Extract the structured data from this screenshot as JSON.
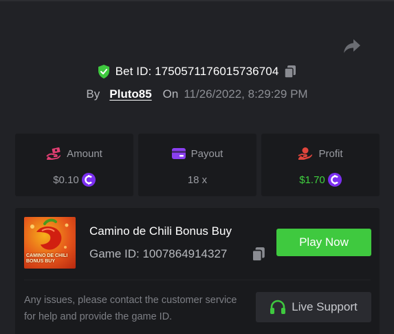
{
  "bet": {
    "id_text": "Bet ID: 1750571176015736704",
    "by_label": "By",
    "username": "Pluto85",
    "on_label": "On",
    "datetime": "11/26/2022, 8:29:29 PM"
  },
  "stats": [
    {
      "label": "Amount",
      "value": "$0.10",
      "icon": "hand-money-icon",
      "coin": true
    },
    {
      "label": "Payout",
      "value": "18 x",
      "icon": "wallet-card-icon",
      "coin": false
    },
    {
      "label": "Profit",
      "value": "$1.70",
      "icon": "profit-hand-icon",
      "coin": true
    }
  ],
  "game": {
    "title": "Camino de Chili Bonus Buy",
    "id_text": "Game ID: 1007864914327",
    "thumbnail_text": "CAMINO DE CHILI BONUS BUY",
    "play_label": "Play Now"
  },
  "support": {
    "notice": "Any issues, please contact the customer service for help and provide the game ID.",
    "button_label": "Live Support"
  },
  "colors": {
    "background": "#212226",
    "card": "#191a1d",
    "accent_green": "#3fc93f",
    "profit_green": "#3fcf3f",
    "coin_purple": "#7b2ff0",
    "amount_icon_pink": "#e03e72",
    "payout_icon_purple": "#8a3ff0",
    "profit_icon_red": "#e0453c",
    "verified_green": "#3fc93f"
  }
}
